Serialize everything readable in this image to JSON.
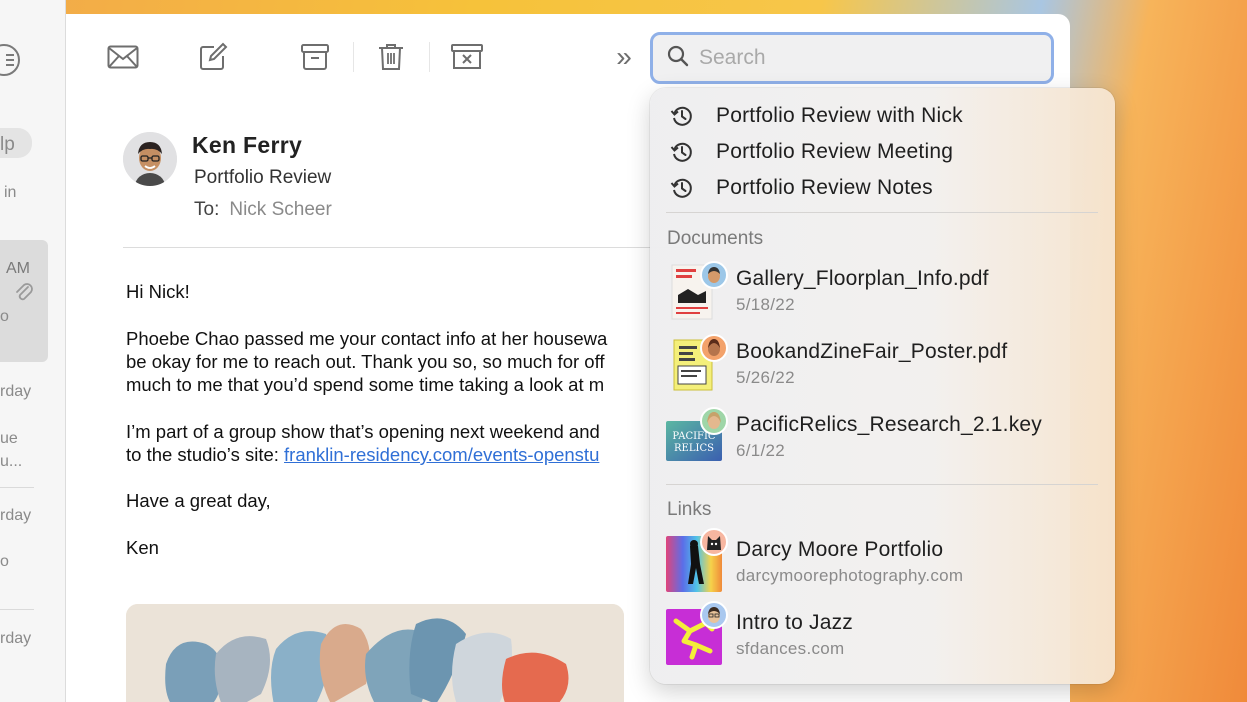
{
  "mail_list_fragments": {
    "top_pill": "lp",
    "in": "in",
    "am": "AM",
    "o1": "o",
    "yesterday1": "rday",
    "tue": "ue",
    "trunc": "u...",
    "yesterday2": "rday",
    "o2": "o",
    "yesterday3": "rday"
  },
  "toolbar": {
    "search_placeholder": "Search",
    "more": "»"
  },
  "message": {
    "sender": "Ken Ferry",
    "subject": "Portfolio Review",
    "to_label": "To:",
    "to_name": "Nick Scheer",
    "greeting": "Hi Nick!",
    "p1_line1": "Phoebe Chao passed me your contact info at her housewa",
    "p1_line2": "be okay for me to reach out. Thank you so, so much for off",
    "p1_line3": "much to me that you’d spend some time taking a look at m",
    "p2_line1": "I’m part of a group show that’s opening next weekend and",
    "p2_line2_prefix": "to the studio’s site: ",
    "p2_link": "franklin-residency.com/events-openstu",
    "closing": "Have a great day,",
    "signature": "Ken"
  },
  "dropdown": {
    "recents": [
      {
        "label": "Portfolio Review with Nick"
      },
      {
        "label": "Portfolio Review Meeting"
      },
      {
        "label": "Portfolio Review Notes"
      }
    ],
    "documents_title": "Documents",
    "documents": [
      {
        "title": "Gallery_Floorplan_Info.pdf",
        "date": "5/18/22"
      },
      {
        "title": "BookandZineFair_Poster.pdf",
        "date": "5/26/22"
      },
      {
        "title": "PacificRelics_Research_2.1.key",
        "date": "6/1/22"
      }
    ],
    "links_title": "Links",
    "links": [
      {
        "title": "Darcy Moore Portfolio",
        "url": "darcymoorephotography.com"
      },
      {
        "title": "Intro to Jazz",
        "url": "sfdances.com"
      }
    ],
    "thumb_text": {
      "gallery": "GALLERY FLOOR",
      "zine": "Book and Zine Fair 2022",
      "pacific": "PACIFIC RELICS"
    }
  }
}
